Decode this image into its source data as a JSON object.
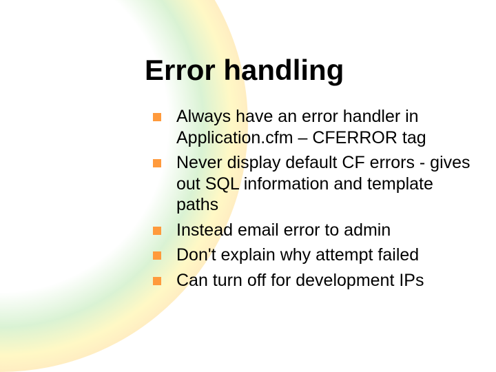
{
  "slide": {
    "title": "Error handling",
    "bullets": [
      "Always have an error handler in Application.cfm – CFERROR tag",
      "Never display default CF errors - gives out SQL information and template paths",
      "Instead email error to admin",
      "Don't explain why attempt failed",
      "Can turn off for development IPs"
    ]
  }
}
